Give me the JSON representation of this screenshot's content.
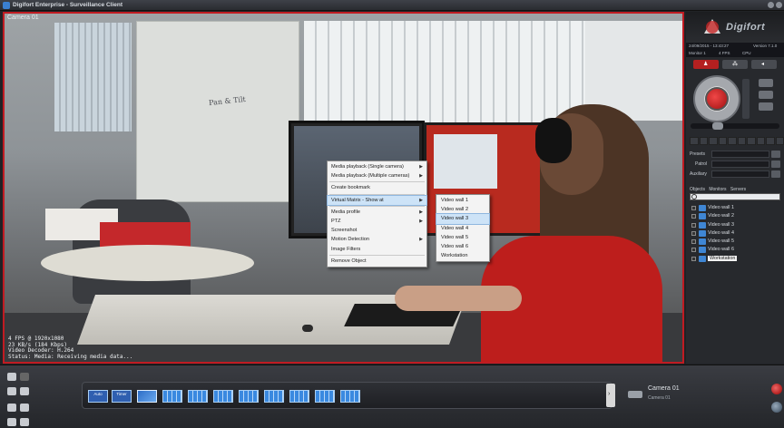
{
  "titlebar": {
    "title": "Digifort Enterprise - Surveillance Client"
  },
  "video": {
    "camera_label": "Camera 01",
    "whiteboard_text": "Pan & Tilt",
    "overlay_lines": [
      "4 FPS @ 1920x1080",
      "23 KB/s (184 Kbps)",
      "Video Decoder: H.264",
      "Status: Media: Receiving media data..."
    ]
  },
  "context_menu": {
    "items": [
      {
        "label": "Media playback (Single camera)",
        "submenu": true
      },
      {
        "label": "Media playback (Multiple cameras)",
        "submenu": true
      },
      {
        "label": "Create bookmark",
        "submenu": false
      },
      {
        "label": "Virtual Matrix - Show at",
        "submenu": true,
        "active": true
      },
      {
        "label": "Media profile",
        "submenu": true
      },
      {
        "label": "PTZ",
        "submenu": true
      },
      {
        "label": "Screenshot",
        "submenu": false
      },
      {
        "label": "Motion Detection",
        "submenu": true
      },
      {
        "label": "Image Filters",
        "submenu": false
      },
      {
        "label": "Remove Object",
        "submenu": false
      }
    ],
    "submenu_items": [
      "Video wall 1",
      "Video wall 2",
      "Video wall 3",
      "Video wall 4",
      "Video wall 5",
      "Video wall 6",
      "Workstation"
    ],
    "submenu_active_index": 2
  },
  "panel": {
    "logo_text": "Digifort",
    "info": {
      "datetime": "24/09/2015 - 13:43:27",
      "version": "Version 7.1.0",
      "monitor": "Monitor 1",
      "fps": "4 FPS",
      "cpu": "CPU"
    },
    "fields": {
      "presets": "Presets",
      "patrol": "Patrol",
      "auxiliary": "Auxiliary"
    },
    "object_tabs": [
      "Objects",
      "Monitors",
      "Servers"
    ],
    "tree": [
      "Video wall 1",
      "Video wall 2",
      "Video wall 3",
      "Video wall 4",
      "Video wall 5",
      "Video wall 6",
      "Workstation"
    ],
    "tree_selected_index": 6
  },
  "bottom": {
    "auto_label": "Auto",
    "timer_label": "Timer",
    "camera_name": "Camera 01",
    "camera_sub": "Camera 01"
  },
  "colors": {
    "selection_border": "#c01b22",
    "accent_blue": "#3a89e0",
    "panel_bg": "#27292d"
  }
}
